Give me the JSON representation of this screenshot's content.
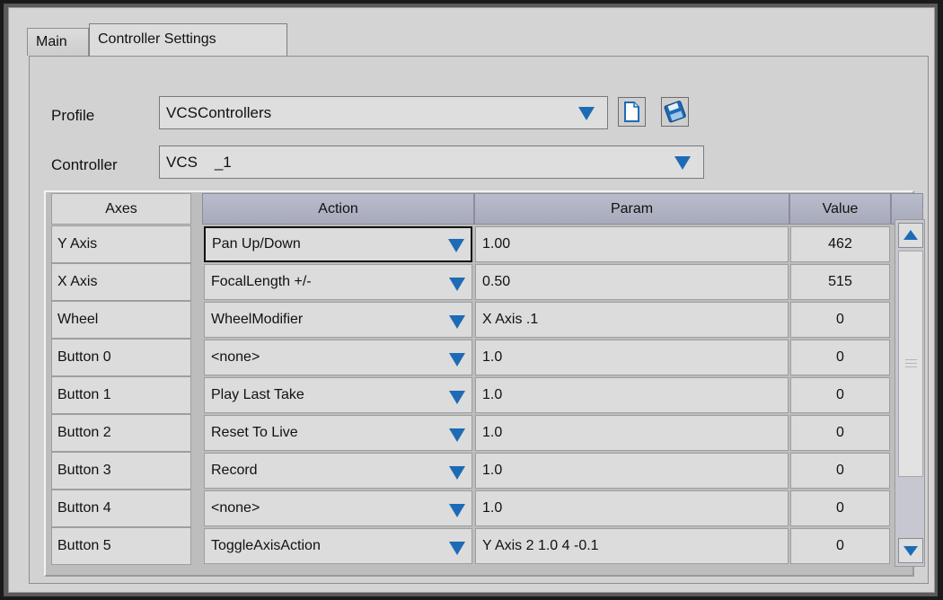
{
  "tabs": [
    {
      "label": "Main"
    },
    {
      "label": "Controller Settings"
    }
  ],
  "profile": {
    "label": "Profile",
    "value": "VCSControllers"
  },
  "controller": {
    "label": "Controller",
    "value": "VCS    _1"
  },
  "grid": {
    "headers": {
      "axes": "Axes",
      "action": "Action",
      "param": "Param",
      "value": "Value"
    },
    "rows": [
      {
        "axis": "Y Axis",
        "action": "Pan Up/Down",
        "param": "1.00",
        "value": "462"
      },
      {
        "axis": "X Axis",
        "action": "FocalLength +/-",
        "param": "0.50",
        "value": "515"
      },
      {
        "axis": "Wheel",
        "action": "WheelModifier",
        "param": "X Axis .1",
        "value": "0"
      },
      {
        "axis": "Button 0",
        "action": "<none>",
        "param": "1.0",
        "value": "0"
      },
      {
        "axis": "Button 1",
        "action": "Play Last Take",
        "param": "1.0",
        "value": "0"
      },
      {
        "axis": "Button 2",
        "action": "Reset To Live",
        "param": "1.0",
        "value": "0"
      },
      {
        "axis": "Button 3",
        "action": "Record",
        "param": "1.0",
        "value": "0"
      },
      {
        "axis": "Button 4",
        "action": "<none>",
        "param": "1.0",
        "value": "0"
      },
      {
        "axis": "Button 5",
        "action": "ToggleAxisAction",
        "param": "Y Axis 2 1.0 4 -0.1",
        "value": "0"
      }
    ]
  },
  "icons": {
    "new": "new-document-icon",
    "save": "save-disk-icon",
    "dropdown": "dropdown-arrow-icon"
  },
  "colors": {
    "accent": "#1e6bb5",
    "header": "#b0b3c4"
  }
}
